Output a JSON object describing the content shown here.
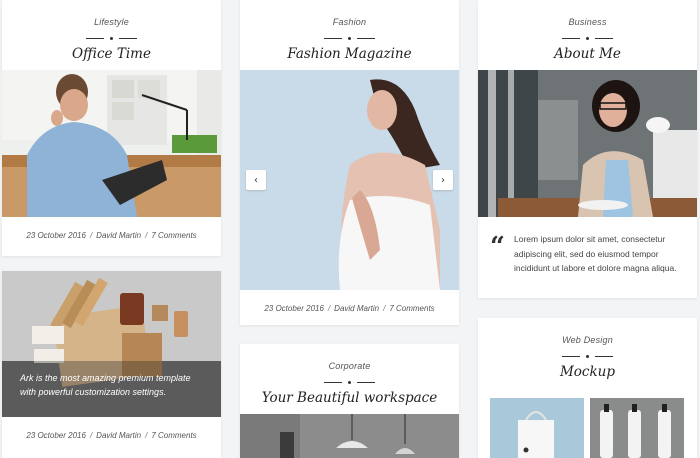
{
  "col1": {
    "card1": {
      "category": "Lifestyle",
      "title": "Office Time",
      "date": "23 October 2016",
      "author": "David Martin",
      "comments": "7 Comments"
    },
    "card2": {
      "overlay": "Ark is the most amazing premium template with powerful customization settings.",
      "date": "23 October 2016",
      "author": "David Martin",
      "comments": "7 Comments"
    }
  },
  "col2": {
    "card1": {
      "category": "Fashion",
      "title": "Fashion Magazine",
      "prev_icon": "‹",
      "next_icon": "›",
      "date": "23 October 2016",
      "author": "David Martin",
      "comments": "7 Comments"
    },
    "card2": {
      "category": "Corporate",
      "title": "Your Beautiful workspace"
    }
  },
  "col3": {
    "card1": {
      "category": "Business",
      "title": "About Me",
      "quote_icon": "“",
      "quote": "Lorem ipsum dolor sit amet, consectetur adipiscing elit, sed do eiusmod tempor incididunt ut labore et dolore magna aliqua."
    },
    "card2": {
      "category": "Web Design",
      "title": "Mockup"
    }
  },
  "meta_separator": "/"
}
